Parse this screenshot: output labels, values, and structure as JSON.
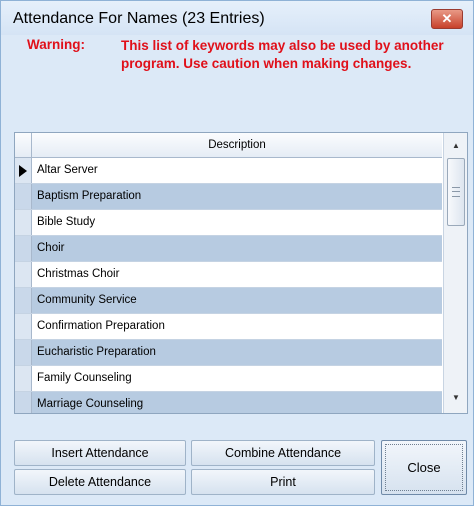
{
  "window": {
    "title": "Attendance For Names (23 Entries)",
    "close_glyph": "✕"
  },
  "warning": {
    "label": "Warning:",
    "text": "This list of keywords may also be used by another program. Use caution when making changes."
  },
  "grid": {
    "column_header": "Description",
    "rows": [
      {
        "description": "Altar Server",
        "current": true
      },
      {
        "description": "Baptism Preparation"
      },
      {
        "description": "Bible Study"
      },
      {
        "description": "Choir"
      },
      {
        "description": "Christmas Choir"
      },
      {
        "description": "Community Service"
      },
      {
        "description": "Confirmation Preparation"
      },
      {
        "description": "Eucharistic Preparation"
      },
      {
        "description": "Family Counseling"
      },
      {
        "description": "Marriage Counseling"
      }
    ],
    "scroll_up_glyph": "▲",
    "scroll_down_glyph": "▼"
  },
  "buttons": {
    "insert": "Insert Attendance",
    "combine": "Combine Attendance",
    "delete": "Delete Attendance",
    "print": "Print",
    "close": "Close"
  },
  "colors": {
    "warning": "#e0101a",
    "alt_row": "#b7cbe1",
    "window_bg": "#dce9f7"
  }
}
